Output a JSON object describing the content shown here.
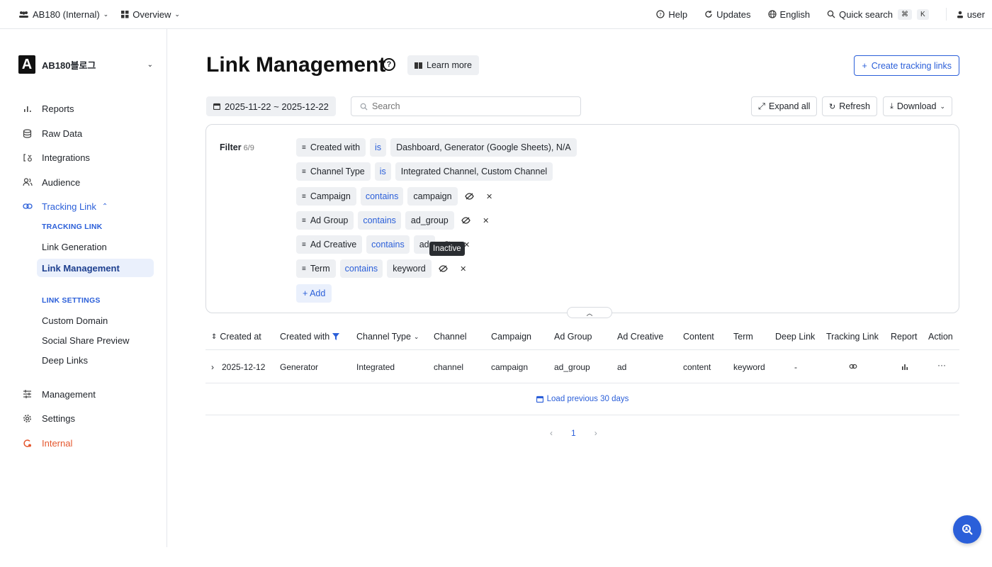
{
  "topbar": {
    "org": "AB180 (Internal)",
    "view": "Overview",
    "help": "Help",
    "updates": "Updates",
    "language": "English",
    "quick_search": "Quick search",
    "kbd_cmd": "⌘",
    "kbd_k": "K",
    "user": "user"
  },
  "sidebar": {
    "workspace_logo": "A",
    "workspace_name": "AB180블로그",
    "items": [
      {
        "label": "Reports"
      },
      {
        "label": "Raw Data"
      },
      {
        "label": "Integrations"
      },
      {
        "label": "Audience"
      },
      {
        "label": "Tracking Link"
      }
    ],
    "tracking_section_head": "TRACKING LINK",
    "tracking_items": [
      "Link Generation",
      "Link Management"
    ],
    "link_settings_head": "LINK SETTINGS",
    "link_settings_items": [
      "Custom Domain",
      "Social Share Preview",
      "Deep Links"
    ],
    "bottom_items": [
      {
        "label": "Management"
      },
      {
        "label": "Settings"
      },
      {
        "label": "Internal"
      }
    ]
  },
  "page": {
    "title": "Link Management",
    "learn_more": "Learn more",
    "create_links": "Create tracking links",
    "date_range": "2025-11-22 ~ 2025-12-22",
    "search_placeholder": "Search",
    "expand_all": "Expand all",
    "refresh": "Refresh",
    "download": "Download"
  },
  "filter": {
    "label": "Filter",
    "count": "6/9",
    "rows": [
      {
        "field": "Created with",
        "op": "is",
        "value": "Dashboard, Generator (Google Sheets), N/A"
      },
      {
        "field": "Channel Type",
        "op": "is",
        "value": "Integrated Channel, Custom Channel"
      },
      {
        "field": "Campaign",
        "op": "contains",
        "value": "campaign"
      },
      {
        "field": "Ad Group",
        "op": "contains",
        "value": "ad_group"
      },
      {
        "field": "Ad Creative",
        "op": "contains",
        "value": "ad"
      },
      {
        "field": "Term",
        "op": "contains",
        "value": "keyword"
      }
    ],
    "add": "+ Add",
    "tooltip": "Inactive"
  },
  "table": {
    "headers": [
      "Created at",
      "Created with",
      "Channel Type",
      "Channel",
      "Campaign",
      "Ad Group",
      "Ad Creative",
      "Content",
      "Term",
      "Deep Link",
      "Tracking Link",
      "Report",
      "Action"
    ],
    "rows": [
      {
        "created_at": "2025-12-12",
        "created_with": "Generator",
        "channel_type": "Integrated",
        "channel": "channel",
        "campaign": "campaign",
        "ad_group": "ad_group",
        "ad_creative": "ad",
        "content": "content",
        "term": "keyword",
        "deep_link": "-",
        "action": "···"
      }
    ],
    "load_previous": "Load previous 30 days"
  },
  "pagination": {
    "prev": "‹",
    "current": "1",
    "next": "›"
  },
  "colors": {
    "accent": "#2b5fd9",
    "internal": "#e4572e"
  }
}
